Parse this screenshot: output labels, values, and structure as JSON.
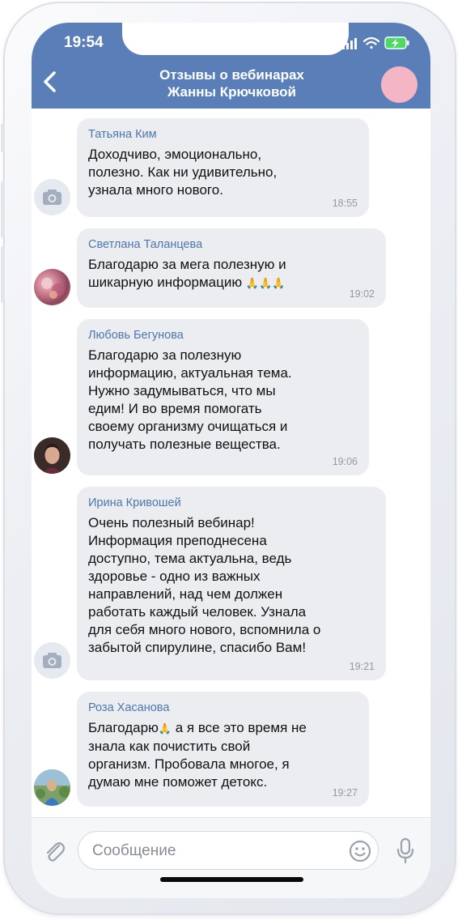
{
  "status_bar": {
    "time": "19:54"
  },
  "header": {
    "title_line1": "Отзывы о вебинарах",
    "title_line2": "Жанны Крючковой"
  },
  "messages": [
    {
      "sender": "Татьяна Ким",
      "lines": [
        "Доходчиво, эмоционально,",
        "полезно. Как ни удивительно,",
        "узнала много нового."
      ],
      "time": "18:55",
      "avatar": "camera-icon"
    },
    {
      "sender": "Светлана Таланцева",
      "lines": [
        "Благодарю за мега полезную и",
        "шикарную информацию"
      ],
      "emoji_suffix": "🙏🙏🙏",
      "time": "19:02",
      "avatar": "photo"
    },
    {
      "sender": "Любовь Бегунова",
      "lines": [
        "Благодарю за полезную",
        "информацию, актуальная тема.",
        "Нужно задумываться, что мы",
        "едим! И во время помогать",
        "своему организму очищаться и",
        "получать полезные вещества."
      ],
      "time": "19:06",
      "avatar": "photo"
    },
    {
      "sender": "Ирина Кривошей",
      "lines": [
        "Очень полезный вебинар!",
        "Информация преподнесена",
        "доступно, тема актуальна, ведь",
        "здоровье - одно из важных",
        "направлений, над чем должен",
        "работать каждый человек. Узнала",
        "для себя много нового, вспомнила о",
        "забытой спирулине, спасибо Вам!"
      ],
      "time": "19:21",
      "avatar": "camera-icon"
    },
    {
      "sender": "Роза Хасанова",
      "line1_pre": "Благодарю",
      "line1_emoji": "🙏",
      "line1_post": " а я все это время не",
      "lines": [
        "знала как почистить свой",
        "организм. Пробовала многое, я",
        "думаю мне поможет детокс."
      ],
      "time": "19:27",
      "avatar": "photo"
    }
  ],
  "composer": {
    "placeholder": "Сообщение"
  },
  "colors": {
    "header": "#5a7fb8",
    "bubble": "#ebedf0",
    "sender": "#4d77ad",
    "header_avatar": "#f4b6c4"
  }
}
